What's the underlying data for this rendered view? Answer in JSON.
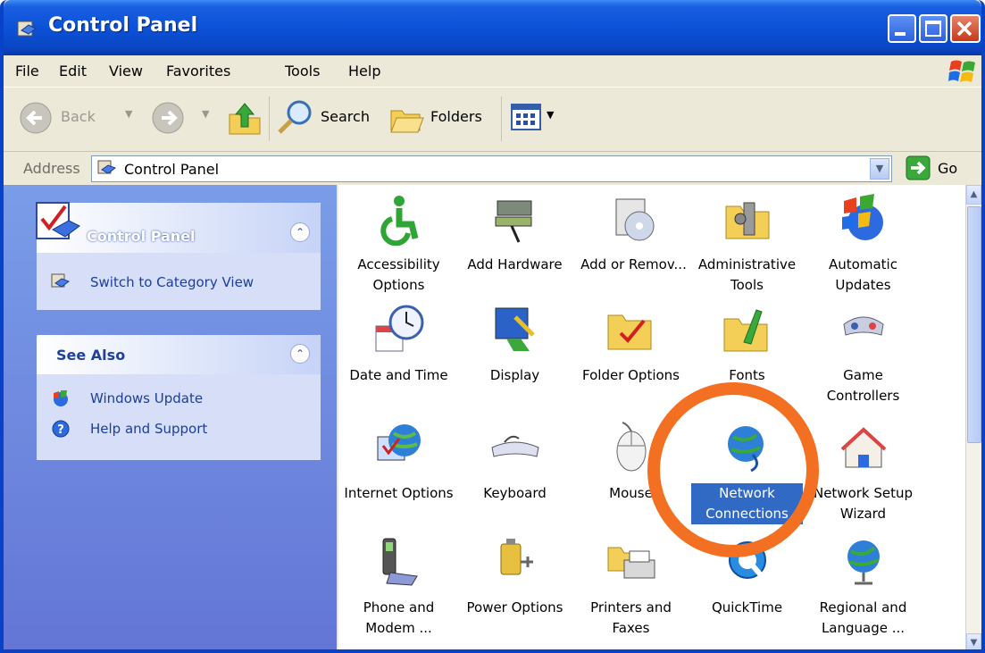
{
  "window": {
    "title": "Control Panel"
  },
  "menu": [
    "File",
    "Edit",
    "View",
    "Favorites",
    "Tools",
    "Help"
  ],
  "toolbar": {
    "back": "Back",
    "search": "Search",
    "folders": "Folders"
  },
  "address": {
    "label": "Address",
    "value": "Control Panel",
    "go": "Go"
  },
  "sidebar": {
    "panel1": {
      "title": "Control Panel",
      "link": "Switch to Category View"
    },
    "panel2": {
      "title": "See Also",
      "links": [
        "Windows Update",
        "Help and Support"
      ]
    }
  },
  "items": [
    {
      "label": "Accessibility Options",
      "icon": "accessibility-icon"
    },
    {
      "label": "Add Hardware",
      "icon": "add-hardware-icon"
    },
    {
      "label": "Add or Remov...",
      "icon": "add-remove-programs-icon"
    },
    {
      "label": "Administrative Tools",
      "icon": "administrative-tools-icon"
    },
    {
      "label": "Automatic Updates",
      "icon": "automatic-updates-icon"
    },
    {
      "label": "Date and Time",
      "icon": "date-time-icon"
    },
    {
      "label": "Display",
      "icon": "display-icon"
    },
    {
      "label": "Folder Options",
      "icon": "folder-options-icon"
    },
    {
      "label": "Fonts",
      "icon": "fonts-icon"
    },
    {
      "label": "Game Controllers",
      "icon": "game-controllers-icon"
    },
    {
      "label": "Internet Options",
      "icon": "internet-options-icon"
    },
    {
      "label": "Keyboard",
      "icon": "keyboard-icon"
    },
    {
      "label": "Mouse",
      "icon": "mouse-icon"
    },
    {
      "label": "Network Connections",
      "icon": "network-connections-icon"
    },
    {
      "label": "Network Setup Wizard",
      "icon": "network-setup-wizard-icon"
    },
    {
      "label": "Phone and Modem ...",
      "icon": "phone-modem-icon"
    },
    {
      "label": "Power Options",
      "icon": "power-options-icon"
    },
    {
      "label": "Printers and Faxes",
      "icon": "printers-faxes-icon"
    },
    {
      "label": "QuickTime",
      "icon": "quicktime-icon"
    },
    {
      "label": "Regional and Language ...",
      "icon": "regional-language-icon"
    }
  ],
  "selected_item": "Network Connections",
  "colors": {
    "title_bar": "#0b52d8",
    "selection": "#316ac5",
    "highlight_circle": "#f36f21",
    "sidebar": "#6f8ade"
  }
}
